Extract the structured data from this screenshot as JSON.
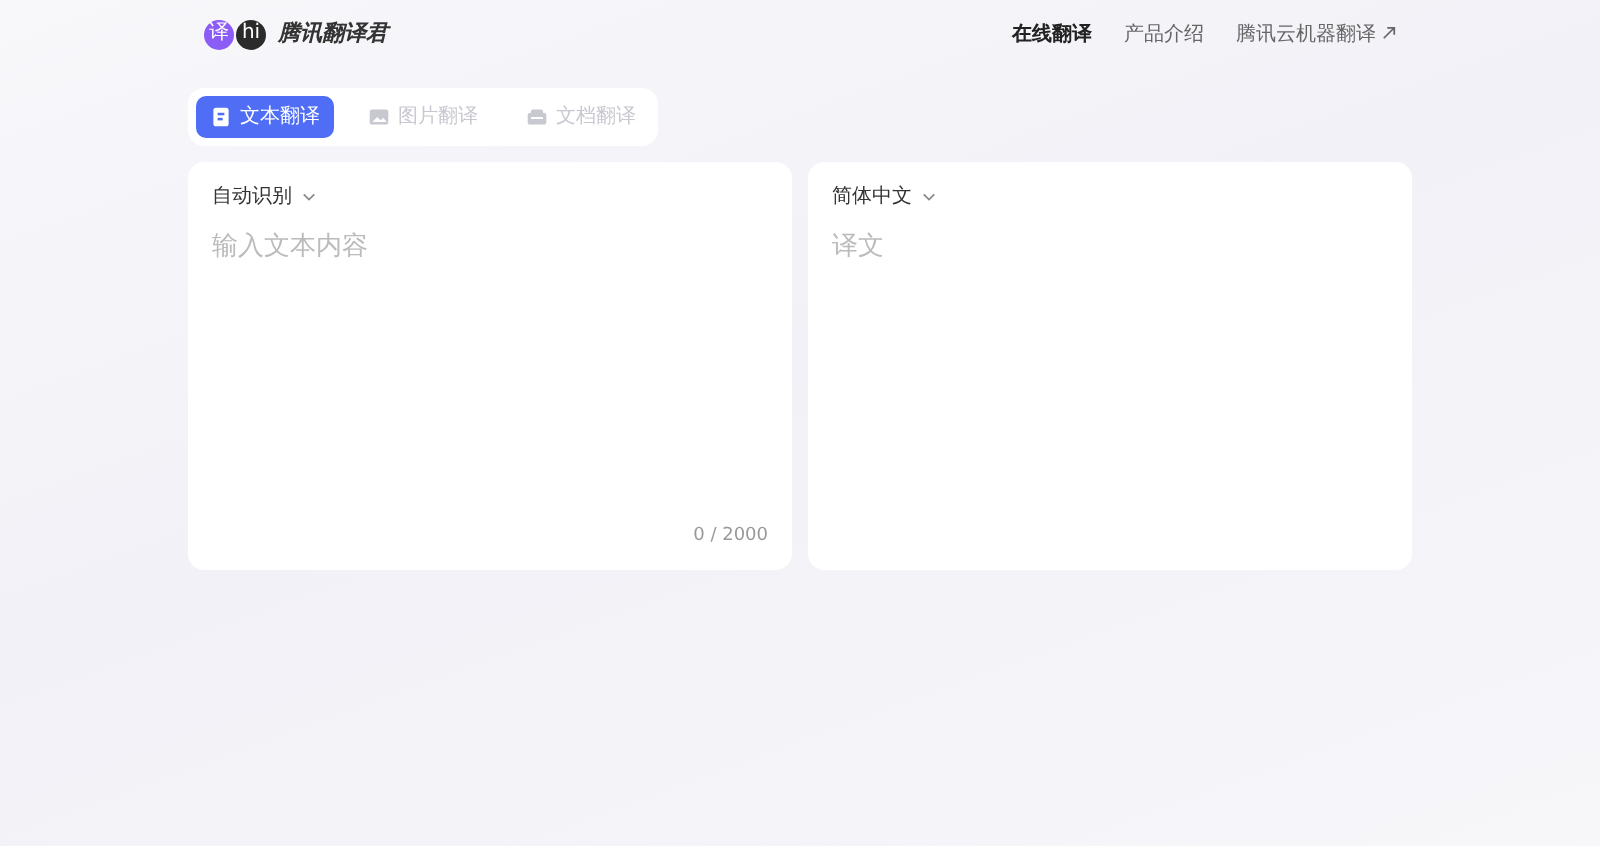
{
  "logo": {
    "badges": [
      "译",
      "hi"
    ],
    "title": "腾讯翻译君"
  },
  "nav": [
    {
      "label": "在线翻译",
      "selected": true,
      "external": false
    },
    {
      "label": "产品介绍",
      "selected": false,
      "external": false
    },
    {
      "label": "腾讯云机器翻译",
      "selected": false,
      "external": true
    }
  ],
  "tabs": [
    {
      "label": "文本翻译",
      "selected": true,
      "kind": "text"
    },
    {
      "label": "图片翻译",
      "selected": false,
      "kind": "image"
    },
    {
      "label": "文档翻译",
      "selected": false,
      "kind": "document"
    }
  ],
  "source": {
    "language": "自动识别",
    "placeholder": "输入文本内容",
    "counter": "0 / 2000"
  },
  "target": {
    "language": "简体中文",
    "placeholder": "译文"
  }
}
